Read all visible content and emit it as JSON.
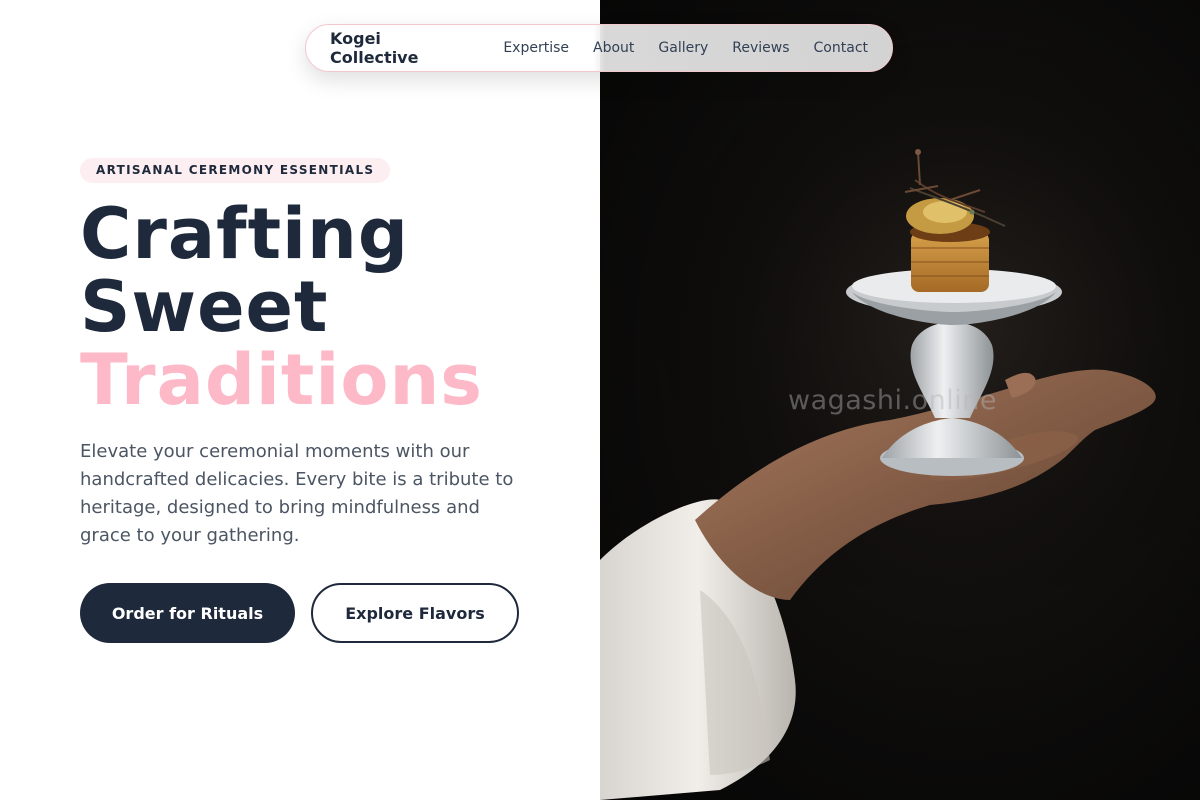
{
  "nav": {
    "brand": "Kogei Collective",
    "links": [
      "Expertise",
      "About",
      "Gallery",
      "Reviews",
      "Contact"
    ]
  },
  "hero": {
    "badge": "ARTISANAL CEREMONY ESSENTIALS",
    "headline_line1": "Crafting",
    "headline_line2": "Sweet",
    "headline_line3": "Traditions",
    "description": "Elevate your ceremonial moments with our handcrafted delicacies. Every bite is a tribute to heritage, designed to bring mindfulness and grace to your gathering.",
    "primary_button": "Order for Rituals",
    "secondary_button": "Explore Flavors"
  },
  "image": {
    "watermark": "wagashi.online"
  },
  "colors": {
    "navy": "#1e293b",
    "pink": "#fdb9c8",
    "badge_bg": "#fdeef1",
    "body_text": "#4b5563"
  }
}
